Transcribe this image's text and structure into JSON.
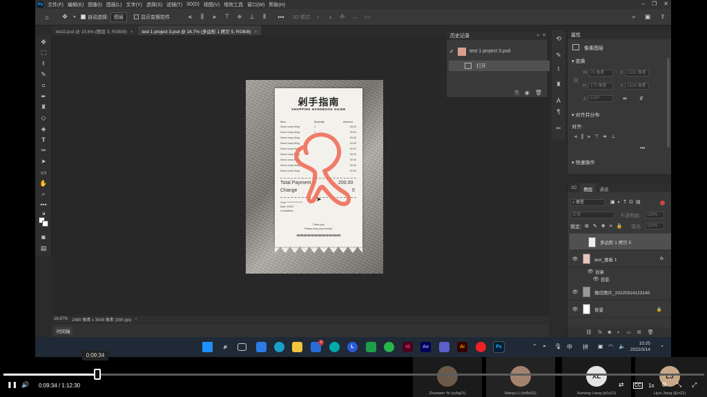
{
  "photoshop": {
    "logo": "Ps",
    "menu": [
      "文件(F)",
      "编辑(E)",
      "图像(I)",
      "图层(L)",
      "文字(Y)",
      "选择(S)",
      "滤镜(T)",
      "3D(D)",
      "视图(V)",
      "增效工具",
      "窗口(W)",
      "帮助(H)"
    ],
    "options": {
      "auto_select_label": "自动选择:",
      "auto_select_value": "图层",
      "transform_label": "显示变换控件",
      "mode_3d": "3D 模式:"
    },
    "tabs": [
      {
        "label": "test2.psd @ 15.6% (图层 3, RGB/8)",
        "close": "×"
      },
      {
        "label": "test 1 project 3.psd @ 16.7% (多边形 1 拷贝 5, RGB/8)",
        "close": "×"
      }
    ],
    "status": {
      "zoom": "16.67%",
      "doc_size": "2480 像素 x 3508 像素 (300 ppi)",
      "arrow": "›"
    },
    "timeline_label": "时间轴"
  },
  "receipt": {
    "title": "剁手指南",
    "subtitle": "SHOPPING HANDBOOK GUIDE",
    "col_item": "Item",
    "col_qty": "Quantity",
    "col_amount": "Amount",
    "rows": [
      {
        "item": "Some crazy thing",
        "qty": "1",
        "amount": "£0.00"
      },
      {
        "item": "Some crazy thing",
        "qty": "1",
        "amount": "£0.00"
      },
      {
        "item": "Some crazy thing",
        "qty": "",
        "amount": "£0.00"
      },
      {
        "item": "Some crazy thing",
        "qty": "",
        "amount": "£0.00"
      },
      {
        "item": "Some crazy thing",
        "qty": "",
        "amount": "£0.00"
      },
      {
        "item": "Some crazy thing",
        "qty": "",
        "amount": "£0.00"
      },
      {
        "item": "Some crazy thing",
        "qty": "",
        "amount": "£0.00"
      },
      {
        "item": "Some crazy thing",
        "qty": "",
        "amount": "£0.00"
      },
      {
        "item": "Some crazy thing",
        "qty": "",
        "amount": "£0.00"
      }
    ],
    "total_label": "Total Payment",
    "total_value": "200.00",
    "change_label": "Change",
    "change_value": "0",
    "card": "Card: ****************",
    "auth": "Auth: 93187",
    "contactless": "Contactless",
    "thanks": "Thank you!",
    "keep": "Please keep your receipt."
  },
  "history": {
    "title": "历史记录",
    "snapshot": "test 1 project 3.psd",
    "open": "打开"
  },
  "properties": {
    "title": "属性",
    "pixel_layer": "像素图层",
    "transform": "变换",
    "w_label": "W",
    "w_value": "70 像素",
    "x_label": "X",
    "x_value": "1101 像素",
    "h_label": "H",
    "h_value": "170 像素",
    "y_label": "Y",
    "y_value": "1104 像素",
    "angle": "0.00°",
    "align": "对齐并分布",
    "align_to": "对齐:",
    "more": "•••",
    "quick": "快速操作"
  },
  "layers": {
    "tabs": [
      "3D",
      "图层",
      "通道"
    ],
    "kind": "类型",
    "mode": "正常",
    "opacity_label": "不透明度:",
    "opacity_value": "100%",
    "lock_label": "锁定:",
    "fill_label": "填充:",
    "fill_value": "100%",
    "items": [
      {
        "name": "多边形 1 拷贝 5"
      },
      {
        "name": "test_画板 1",
        "fx": "fx"
      },
      {
        "name": "微信图片_20220314123140"
      },
      {
        "name": "背景"
      }
    ],
    "effects": "效果",
    "shadow": "投影"
  },
  "taskbar": {
    "time": "15:25",
    "date": "2022/3/14",
    "badge": "3",
    "ime_zh": "中",
    "ime_pin": "拼"
  },
  "video": {
    "current": "0:09:34",
    "separator": "/",
    "total": "1:12:30",
    "tooltip": "0:09:34",
    "speed": "1x",
    "progress": 0.134,
    "participants": [
      {
        "name": "Zhuowen Ye (zy9g21)",
        "initials": ""
      },
      {
        "name": "Manyu Li (ml5n21)",
        "initials": ""
      },
      {
        "name": "Xumeng Liang (xl1u21)",
        "initials": "XL"
      },
      {
        "name": "Lijun Jiang (lj1n21)",
        "initials": "LJ"
      }
    ]
  },
  "colors": {
    "accent": "#f06e5a",
    "taskbar": "#1f2a36"
  }
}
